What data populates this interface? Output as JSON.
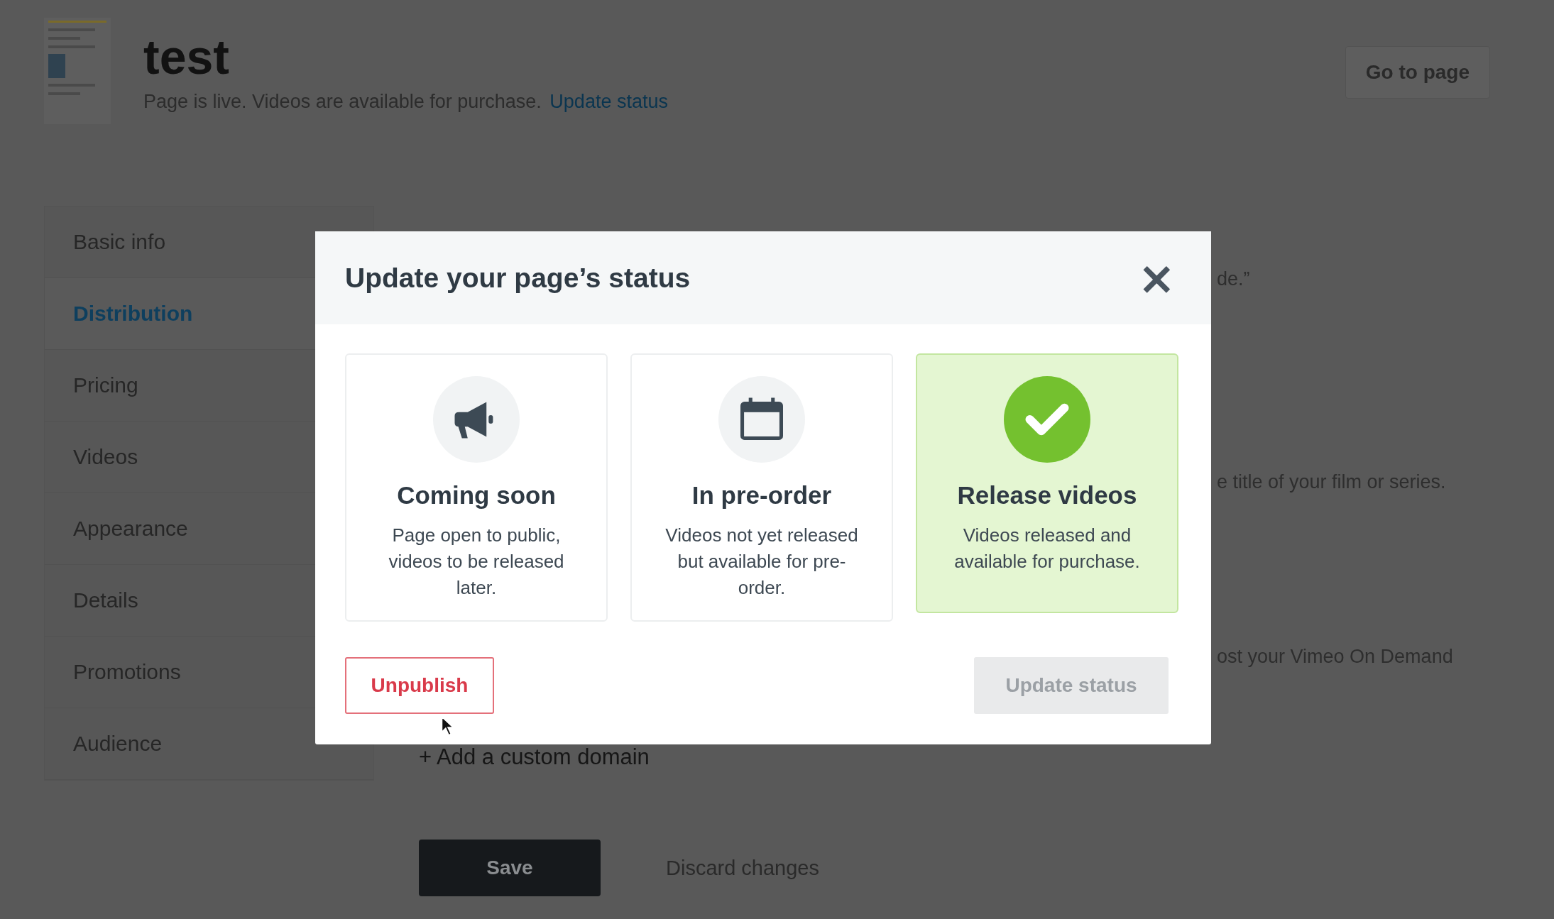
{
  "page": {
    "title": "test",
    "status_text": "Page is live. Videos are available for purchase.",
    "status_link": "Update status",
    "go_button": "Go to page"
  },
  "sidebar": {
    "items": [
      {
        "label": "Basic info",
        "selected": false
      },
      {
        "label": "Distribution",
        "selected": true
      },
      {
        "label": "Pricing",
        "selected": false
      },
      {
        "label": "Videos",
        "selected": false
      },
      {
        "label": "Appearance",
        "selected": false
      },
      {
        "label": "Details",
        "selected": false
      },
      {
        "label": "Promotions",
        "selected": false
      },
      {
        "label": "Audience",
        "selected": false
      }
    ]
  },
  "content": {
    "partial_lines": [
      "de.”",
      "e title of your film or series.",
      "ost your Vimeo On Demand"
    ],
    "add_domain": "+ Add a custom domain",
    "save": "Save",
    "discard": "Discard changes"
  },
  "modal": {
    "title": "Update your page’s status",
    "close": "×",
    "options": [
      {
        "kind": "megaphone",
        "title": "Coming soon",
        "description": "Page open to public, videos to be released later.",
        "selected": false
      },
      {
        "kind": "calendar",
        "title": "In pre-order",
        "description": "Videos not yet released but available for pre-order.",
        "selected": false
      },
      {
        "kind": "check",
        "title": "Release videos",
        "description": "Videos released and available for purchase.",
        "selected": true
      }
    ],
    "unpublish": "Unpublish",
    "update": {
      "label": "Update status",
      "disabled": true
    }
  }
}
